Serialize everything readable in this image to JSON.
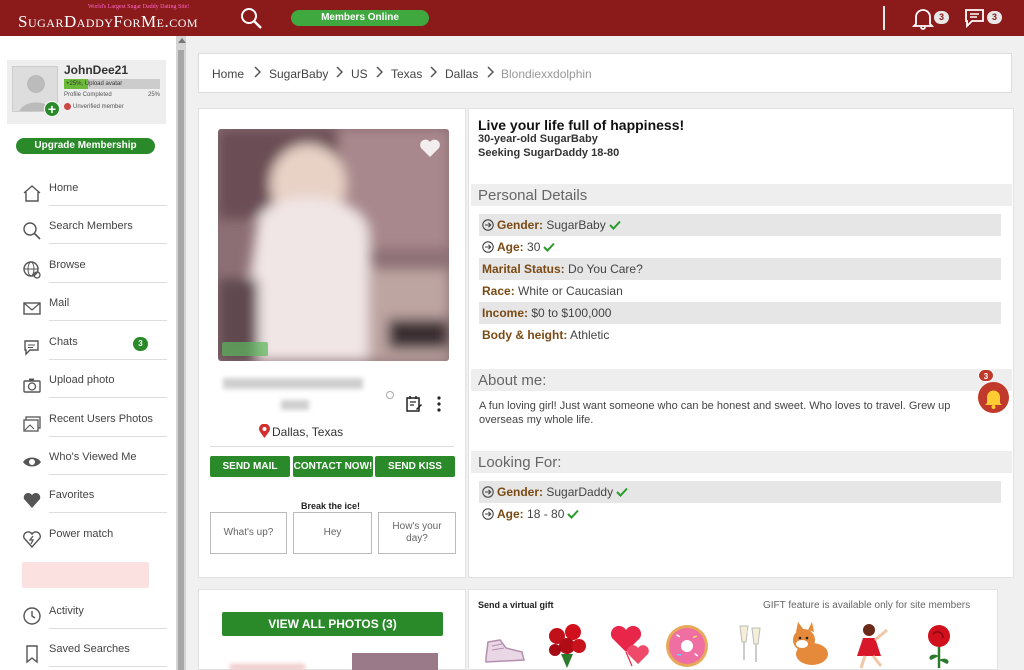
{
  "header": {
    "logo_tagline": "World's Largest Sugar Daddy Dating Site!",
    "logo_text": "SugarDaddyForMe.com",
    "members_online": "Members Online",
    "notifications_count": "3",
    "messages_count": "3"
  },
  "sidebar": {
    "username": "JohnDee21",
    "upload_bar_text": "+25%, Upload avatar",
    "profile_completed_label": "Profile Completed",
    "profile_completed_value": "25%",
    "unverified": "Unverified member",
    "upgrade_label": "Upgrade Membership",
    "items": [
      {
        "label": "Home",
        "icon": "home-icon"
      },
      {
        "label": "Search Members",
        "icon": "search-icon"
      },
      {
        "label": "Browse",
        "icon": "globe-icon"
      },
      {
        "label": "Mail",
        "icon": "mail-icon"
      },
      {
        "label": "Chats",
        "icon": "chat-icon",
        "badge": "3"
      },
      {
        "label": "Upload photo",
        "icon": "camera-icon"
      },
      {
        "label": "Recent Users Photos",
        "icon": "photos-icon"
      },
      {
        "label": "Who's Viewed Me",
        "icon": "eye-icon"
      },
      {
        "label": "Favorites",
        "icon": "heart-icon"
      },
      {
        "label": "Power match",
        "icon": "power-match-icon"
      },
      {
        "label": "Activity",
        "icon": "clock-icon"
      },
      {
        "label": "Saved Searches",
        "icon": "bookmark-icon"
      }
    ]
  },
  "breadcrumb": [
    "Home",
    "SugarBaby",
    "US",
    "Texas",
    "Dallas",
    "Blondiexxdolphin"
  ],
  "profile": {
    "location": "Dallas, Texas",
    "buttons": {
      "send_mail": "SEND MAIL",
      "contact_now": "CONTACT NOW!",
      "send_kiss": "SEND KISS"
    },
    "break_ice": "Break the ice!",
    "ice_options": [
      "What's up?",
      "Hey",
      "How's your day?"
    ],
    "headline": "Live your life full of happiness!",
    "age_line": "30-year-old SugarBaby",
    "seeking_line": "Seeking SugarDaddy 18-80",
    "personal_details_title": "Personal Details",
    "details": [
      {
        "key": "Gender:",
        "value": "SugarBaby",
        "arrow": true,
        "check": true
      },
      {
        "key": "Age:",
        "value": "30",
        "arrow": true,
        "check": true
      },
      {
        "key": "Marital Status:",
        "value": "Do You Care?",
        "arrow": false,
        "check": false
      },
      {
        "key": "Race:",
        "value": "White or Caucasian",
        "arrow": false,
        "check": false
      },
      {
        "key": "Income:",
        "value": "$0 to $100,000",
        "arrow": false,
        "check": false
      },
      {
        "key": "Body & height:",
        "value": "Athletic",
        "arrow": false,
        "check": false
      }
    ],
    "about_title": "About me:",
    "about_text": "A fun loving girl! Just want someone who can be honest and sweet. Who loves to travel. Grew up overseas my whole life.",
    "looking_title": "Looking For:",
    "looking": [
      {
        "key": "Gender:",
        "value": "SugarDaddy"
      },
      {
        "key": "Age:",
        "value": "18 - 80"
      }
    ],
    "float_badge": "3"
  },
  "photos": {
    "view_all": "VIEW ALL PHOTOS (3)"
  },
  "gifts": {
    "title": "Send a virtual gift",
    "note": "GIFT feature is available only for site members",
    "items": [
      "sneaker-gift",
      "roses-gift",
      "hearts-gift",
      "donut-gift",
      "champagne-gift",
      "shiba-gift",
      "dancer-gift",
      "rose-gift"
    ]
  },
  "colors": {
    "brand": "#8b1a1a",
    "accent_green": "#2a8a2a",
    "key_brown": "#7a4a14"
  }
}
